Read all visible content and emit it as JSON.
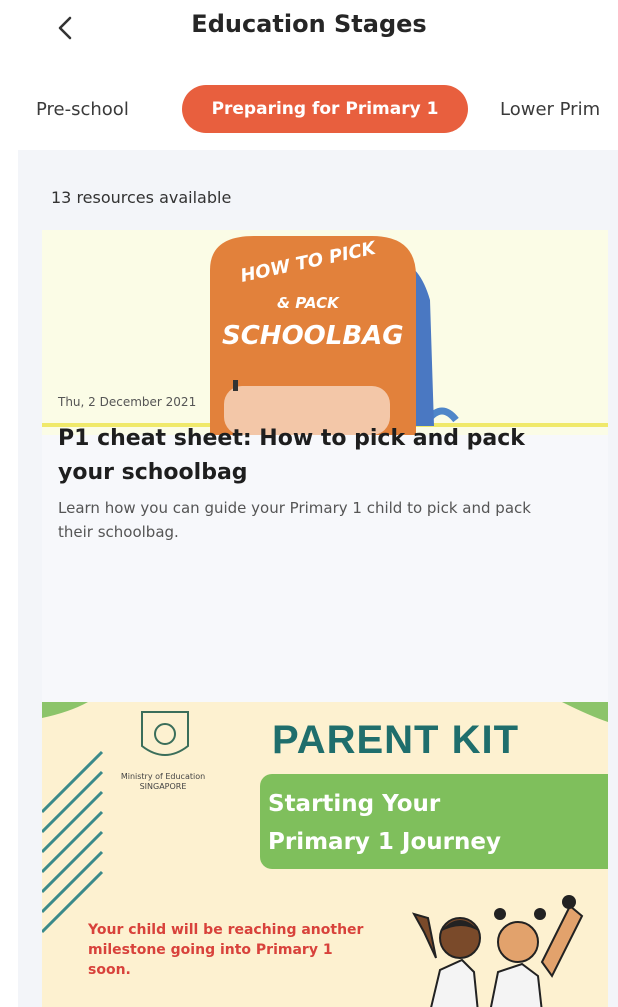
{
  "header": {
    "title": "Education Stages",
    "back_icon": "chevron-left-icon"
  },
  "tabs": [
    {
      "label": "Pre-school",
      "active": false
    },
    {
      "label": "Preparing for Primary 1",
      "active": true
    },
    {
      "label": "Lower Prim",
      "active": false
    }
  ],
  "main": {
    "resource_count": "13 resources available"
  },
  "cards": [
    {
      "image_text": [
        "HOW TO PICK",
        "& PACK",
        "SCHOOLBAG"
      ],
      "date": "Thu, 2 December 2021",
      "title": "P1 cheat sheet: How to pick and pack your schoolbag",
      "description": "Learn how you can guide your Primary 1 child to pick and pack their schoolbag."
    },
    {
      "org_label": "Ministry of Education SINGAPORE",
      "kit_title": "PARENT KIT",
      "subtitle_line1": "Starting Your",
      "subtitle_line2": "Primary 1 Journey",
      "milestone_text": "Your child will be reaching another milestone going into Primary 1 soon."
    }
  ],
  "colors": {
    "accent": "#e85f3e",
    "backpack": "#e2813b",
    "kit_title": "#1f6e6c",
    "kit_green": "#7fbf5c",
    "milestone_red": "#d8423b"
  }
}
